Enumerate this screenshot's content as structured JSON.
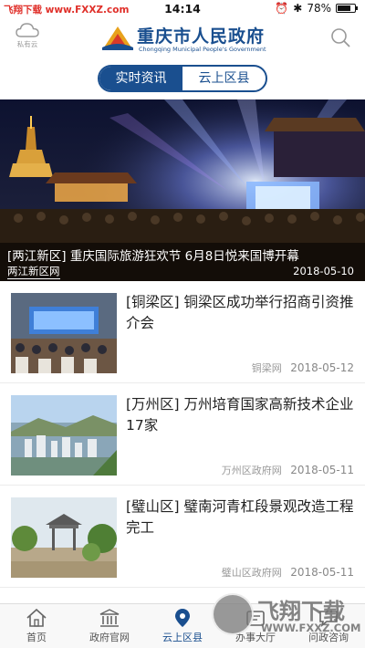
{
  "status_bar": {
    "watermark": "飞翔下载 www.FXXZ.com",
    "time": "14:14",
    "battery": "78%",
    "battery_level": 0.78
  },
  "header": {
    "cloud_label": "私有云",
    "title": "重庆市人民政府",
    "subtitle": "Chongqing Municipal People's Government"
  },
  "segment": {
    "tabs": [
      {
        "label": "实时资讯",
        "active": true
      },
      {
        "label": "云上区县",
        "active": false
      }
    ]
  },
  "hero": {
    "title": "[两江新区] 重庆国际旅游狂欢节 6月8日悦来国博开幕",
    "source": "两江新区网",
    "date": "2018-05-10"
  },
  "news": [
    {
      "title": "[铜梁区] 铜梁区成功举行招商引资推介会",
      "source": "铜梁网",
      "date": "2018-05-12"
    },
    {
      "title": "[万州区] 万州培育国家高新技术企业17家",
      "source": "万州区政府网",
      "date": "2018-05-11"
    },
    {
      "title": "[璧山区] 璧南河青杠段景观改造工程完工",
      "source": "璧山区政府网",
      "date": "2018-05-11"
    }
  ],
  "tabbar": {
    "items": [
      {
        "label": "首页",
        "icon": "home-icon",
        "active": false
      },
      {
        "label": "政府官网",
        "icon": "government-building-icon",
        "active": false
      },
      {
        "label": "云上区县",
        "icon": "map-pin-icon",
        "active": true
      },
      {
        "label": "办事大厅",
        "icon": "service-hall-icon",
        "active": false
      },
      {
        "label": "问政咨询",
        "icon": "consult-icon",
        "active": false
      }
    ]
  },
  "watermark": {
    "brand": "飞翔下载",
    "url": "WWW.FXXZ.COM"
  },
  "colors": {
    "brand": "#1a4f8f",
    "watermark_red": "#e0302a"
  }
}
